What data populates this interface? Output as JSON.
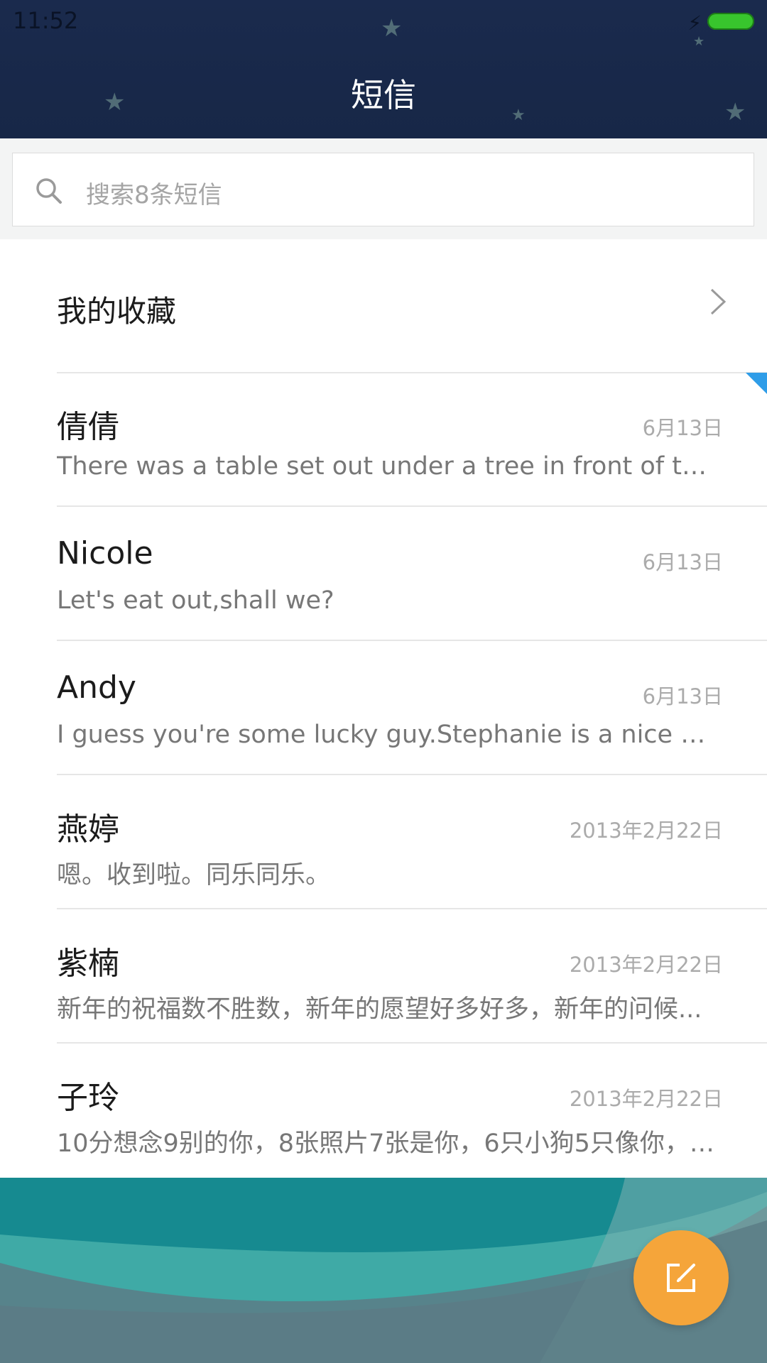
{
  "status_bar": {
    "time": "11:52"
  },
  "header": {
    "title": "短信"
  },
  "search": {
    "placeholder": "搜索8条短信"
  },
  "favorites": {
    "label": "我的收藏"
  },
  "conversations": [
    {
      "name": "倩倩",
      "date": "6月13日",
      "preview": "There was a table set out under a tree in front of the ho...",
      "unread": true
    },
    {
      "name": "Nicole",
      "date": "6月13日",
      "preview": "Let's eat out,shall we?"
    },
    {
      "name": "Andy",
      "date": "6月13日",
      "preview": "I guess you're some lucky guy.Stephanie is a nice girl."
    },
    {
      "name": "燕婷",
      "date": "2013年2月22日",
      "preview": "嗯。收到啦。同乐同乐。"
    },
    {
      "name": "紫楠",
      "date": "2013年2月22日",
      "preview": "新年的祝福数不胜数，新年的愿望好多好多，新年的问候..."
    },
    {
      "name": "子玲",
      "date": "2013年2月22日",
      "preview": "10分想念9别的你，8张照片7张是你，6只小狗5只像你，4..."
    }
  ],
  "fab": {
    "icon": "compose-icon"
  },
  "colors": {
    "header_bg": "#1a2a4d",
    "fab": "#f5a53a",
    "unread": "#2f9de8"
  }
}
